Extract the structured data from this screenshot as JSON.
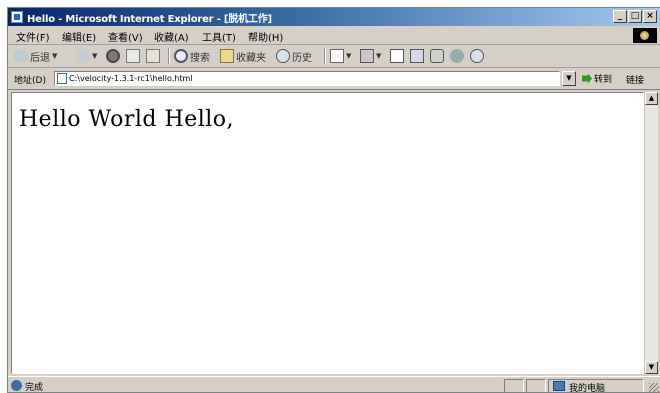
{
  "window": {
    "title": "Hello - Microsoft Internet Explorer - [脱机工作]",
    "controls": [
      "_",
      "□",
      "×"
    ]
  },
  "menu": {
    "items": [
      "文件(F)",
      "编辑(E)",
      "查看(V)",
      "收藏(A)",
      "工具(T)",
      "帮助(H)"
    ]
  },
  "toolbar": {
    "back_label": "后退",
    "search_label": "搜索",
    "favorites_label": "收藏夹",
    "history_label": "历史"
  },
  "address": {
    "label": "地址(D)",
    "value": "C:\\velocity-1.3.1-rc1\\hello.html",
    "go_label": "转到",
    "links_label": "链接"
  },
  "page": {
    "content_text": "Hello World Hello,"
  },
  "status": {
    "text": "完成",
    "zone_label": "我的电脑"
  }
}
